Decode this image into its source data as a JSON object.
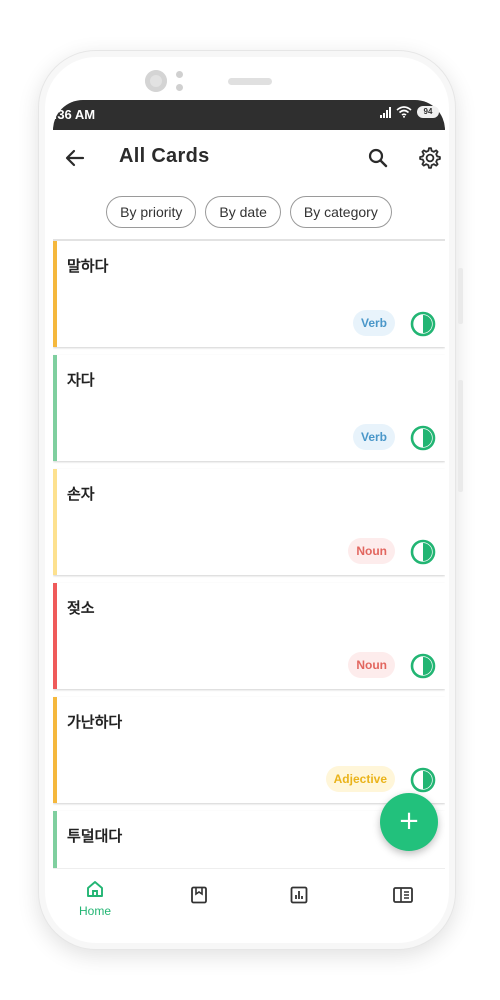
{
  "status_bar": {
    "time": ":36 AM",
    "battery": "94"
  },
  "header": {
    "title": "All Cards"
  },
  "filters": [
    "By priority",
    "By date",
    "By category"
  ],
  "cards": [
    {
      "word": "말하다",
      "category": "Verb",
      "stripe_color": "#f5b83d",
      "badge_bg": "#e8f3fb",
      "badge_fg": "#4a97c9"
    },
    {
      "word": "자다",
      "category": "Verb",
      "stripe_color": "#7fcf9f",
      "badge_bg": "#e8f3fb",
      "badge_fg": "#4a97c9"
    },
    {
      "word": "손자",
      "category": "Noun",
      "stripe_color": "#fde18f",
      "badge_bg": "#fdecec",
      "badge_fg": "#e2665f"
    },
    {
      "word": "젖소",
      "category": "Noun",
      "stripe_color": "#ef5a5a",
      "badge_bg": "#fdecec",
      "badge_fg": "#e2665f"
    },
    {
      "word": "가난하다",
      "category": "Adjective",
      "stripe_color": "#f5b83d",
      "badge_bg": "#fff6d9",
      "badge_fg": "#eab31a"
    },
    {
      "word": "투덜대다",
      "category": "",
      "stripe_color": "#7fcf9f",
      "badge_bg": "",
      "badge_fg": ""
    }
  ],
  "fab": {
    "label": "+"
  },
  "bottom_nav": {
    "home_label": "Home"
  },
  "colors": {
    "accent": "#22c17c",
    "header_bg": "#2f2f2f",
    "progress": "#22b573"
  },
  "icons": [
    "back-arrow-icon",
    "search-icon",
    "gear-icon",
    "half-circle-progress-icon",
    "plus-icon",
    "home-icon",
    "bookmark-icon",
    "bar-chart-icon",
    "book-icon"
  ]
}
